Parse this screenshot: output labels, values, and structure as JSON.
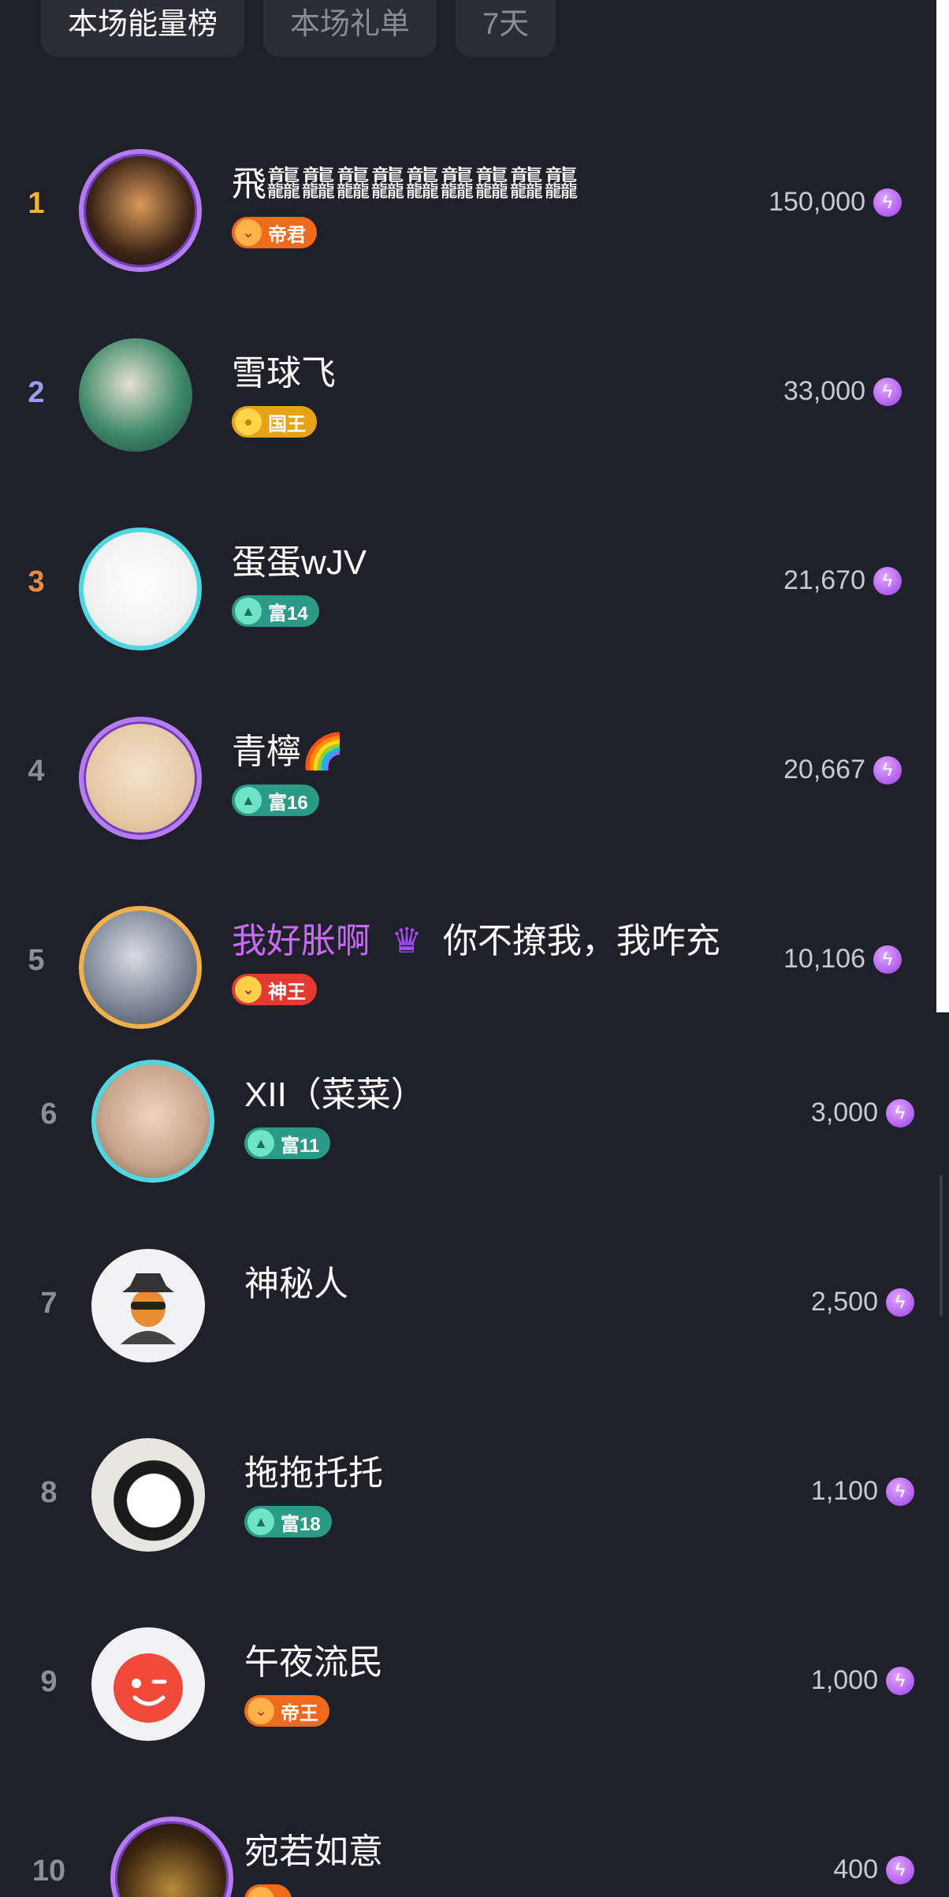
{
  "tabs": [
    {
      "label": "本场能量榜",
      "active": true
    },
    {
      "label": "本场礼单",
      "active": false
    },
    {
      "label": "7天",
      "active": false
    }
  ],
  "colors": {
    "background": "#20202a",
    "rank1": "#f2b23a",
    "rank2": "#9a9cf0",
    "rank3": "#e98a3c",
    "rank_default": "#8e8e99",
    "vip_name": "#c86af2",
    "energy_icon": "#a64cf0"
  },
  "rows": [
    {
      "rank": "1",
      "name": "飛龘龘龘龘龘龘龘龘龘",
      "badge": "帝君",
      "score": "150,000",
      "icon": "energy-bolt-icon"
    },
    {
      "rank": "2",
      "name": "雪球飞",
      "badge": "国王",
      "score": "33,000",
      "icon": "energy-bolt-icon"
    },
    {
      "rank": "3",
      "name": "蛋蛋wJV",
      "badge": "富14",
      "score": "21,670",
      "icon": "energy-bolt-icon"
    },
    {
      "rank": "4",
      "name": "青檸🌈",
      "badge": "富16",
      "score": "20,667",
      "icon": "energy-bolt-icon"
    },
    {
      "rank": "5",
      "name_vip": "我好胀啊",
      "name_suffix": "你不撩我，我咋充",
      "badge": "神王",
      "score": "10,106",
      "icon": "energy-bolt-icon"
    },
    {
      "rank": "6",
      "name": "XII（菜菜）",
      "badge": "富11",
      "score": "3,000",
      "icon": "energy-bolt-icon"
    },
    {
      "rank": "7",
      "name": "神秘人",
      "score": "2,500",
      "icon": "energy-bolt-icon"
    },
    {
      "rank": "8",
      "name": "拖拖托托",
      "badge": "富18",
      "score": "1,100",
      "icon": "energy-bolt-icon"
    },
    {
      "rank": "9",
      "name": "午夜流民",
      "badge": "帝王",
      "score": "1,000",
      "icon": "energy-bolt-icon"
    },
    {
      "rank": "10",
      "name": "宛若如意",
      "score": "400",
      "icon": "energy-bolt-icon"
    }
  ]
}
